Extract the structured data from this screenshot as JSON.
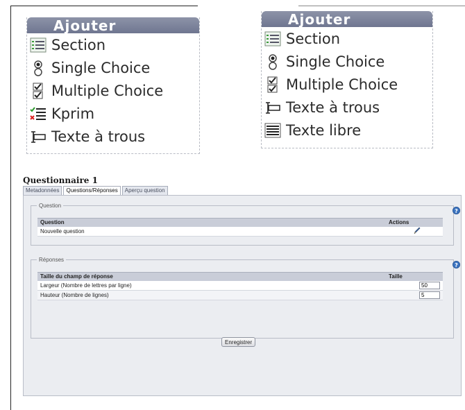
{
  "menus": [
    {
      "header": "Ajouter",
      "items": [
        {
          "label": "Section",
          "icon": "section-icon"
        },
        {
          "label": "Single Choice",
          "icon": "single-choice-icon"
        },
        {
          "label": "Multiple Choice",
          "icon": "multiple-choice-icon"
        },
        {
          "label": "Kprim",
          "icon": "kprim-icon"
        },
        {
          "label": "Texte à trous",
          "icon": "cloze-icon"
        }
      ]
    },
    {
      "header": "Ajouter",
      "items": [
        {
          "label": "Section",
          "icon": "section-icon"
        },
        {
          "label": "Single Choice",
          "icon": "single-choice-icon"
        },
        {
          "label": "Multiple Choice",
          "icon": "multiple-choice-icon"
        },
        {
          "label": "Texte à trous",
          "icon": "cloze-icon"
        },
        {
          "label": "Texte libre",
          "icon": "free-text-icon"
        }
      ]
    }
  ],
  "questionnaire": {
    "title": "Questionnaire 1",
    "tabs": [
      "Metadonnées",
      "Questions/Réponses",
      "Aperçu question"
    ],
    "active_tab": "Questions/Réponses"
  },
  "question_section": {
    "legend": "Question",
    "columns": [
      "Question",
      "Actions"
    ],
    "rows": [
      {
        "question": "Nouvelle question",
        "action_icon": "pencil-icon"
      }
    ]
  },
  "responses_section": {
    "legend": "Réponses",
    "columns": [
      "Taille du champ de réponse",
      "Taille"
    ],
    "rows": [
      {
        "label": "Largeur (Nombre de lettres par ligne)",
        "value": "50"
      },
      {
        "label": "Hauteur (Nombre de lignes)",
        "value": "5"
      }
    ]
  },
  "save_label": "Enregistrer",
  "colors": {
    "menu_header": "#7a8099",
    "table_header": "#c9cdd8",
    "panel_bg": "#ebedf1",
    "help_icon": "#3c74c0"
  }
}
